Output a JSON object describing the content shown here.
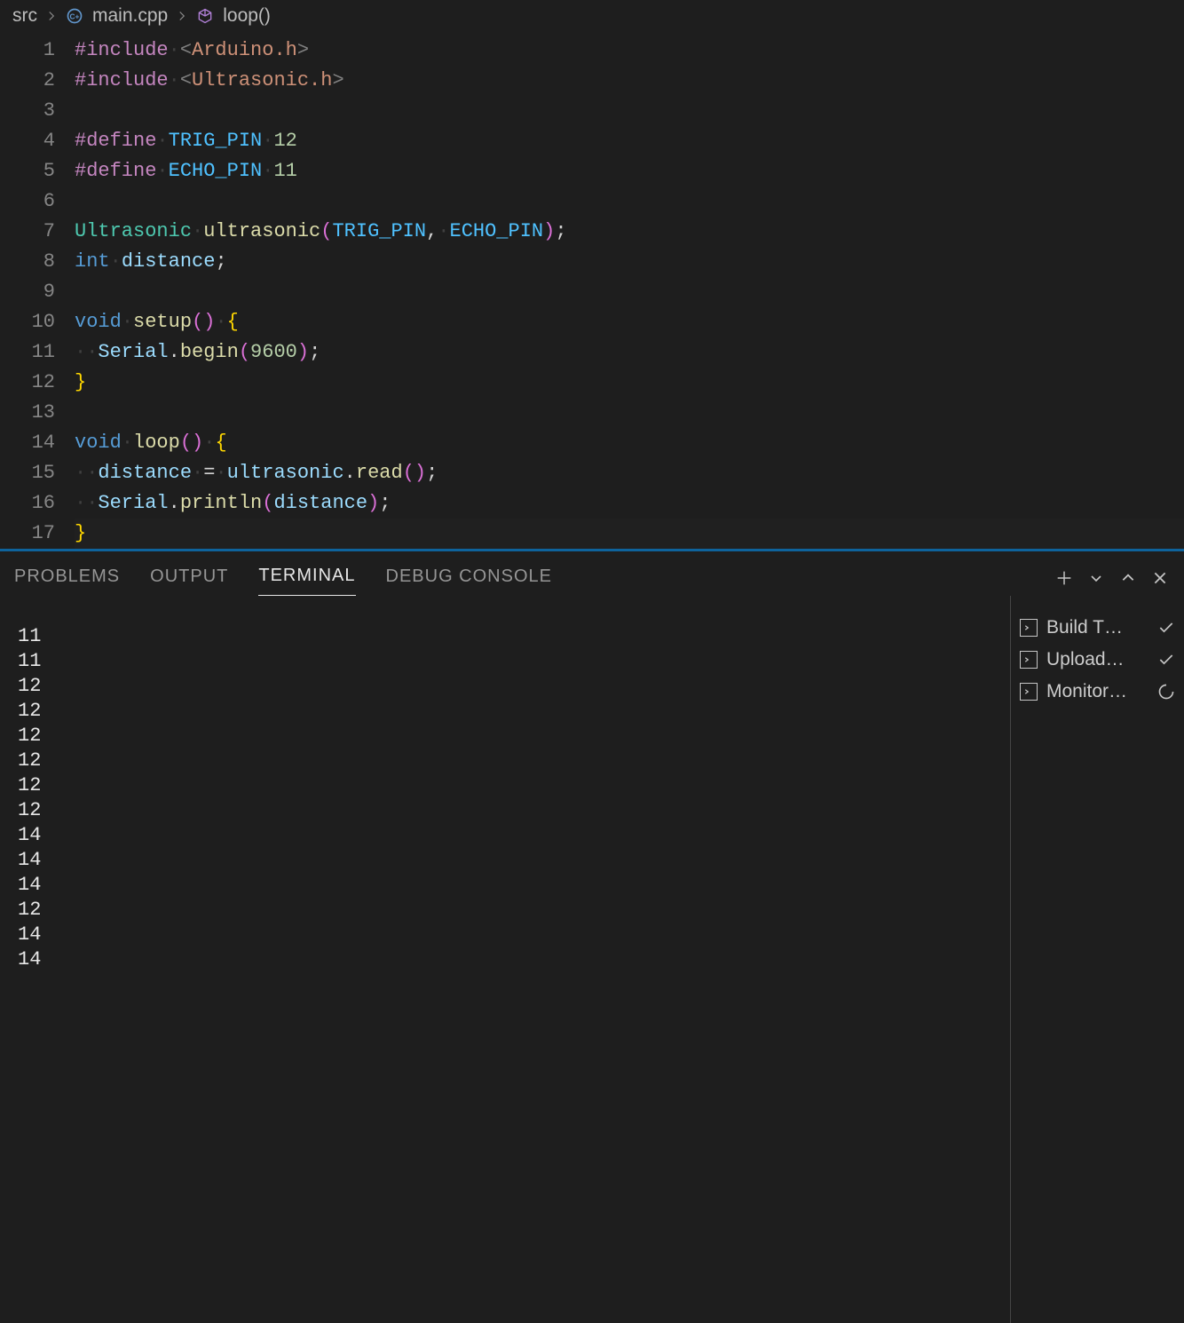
{
  "breadcrumb": {
    "folder": "src",
    "file": "main.cpp",
    "symbol": "loop()"
  },
  "code": {
    "lines": [
      {
        "n": 1,
        "tokens": [
          [
            "kw",
            "#include"
          ],
          [
            "ws",
            "·"
          ],
          [
            "angle",
            "<"
          ],
          [
            "str",
            "Arduino.h"
          ],
          [
            "angle",
            ">"
          ]
        ]
      },
      {
        "n": 2,
        "tokens": [
          [
            "kw",
            "#include"
          ],
          [
            "ws",
            "·"
          ],
          [
            "angle",
            "<"
          ],
          [
            "str",
            "Ultrasonic.h"
          ],
          [
            "angle",
            ">"
          ]
        ]
      },
      {
        "n": 3,
        "tokens": []
      },
      {
        "n": 4,
        "tokens": [
          [
            "kw",
            "#define"
          ],
          [
            "ws",
            "·"
          ],
          [
            "mac",
            "TRIG_PIN"
          ],
          [
            "ws",
            "·"
          ],
          [
            "num",
            "12"
          ]
        ]
      },
      {
        "n": 5,
        "tokens": [
          [
            "kw",
            "#define"
          ],
          [
            "ws",
            "·"
          ],
          [
            "mac",
            "ECHO_PIN"
          ],
          [
            "ws",
            "·"
          ],
          [
            "num",
            "11"
          ]
        ]
      },
      {
        "n": 6,
        "tokens": []
      },
      {
        "n": 7,
        "tokens": [
          [
            "type",
            "Ultrasonic"
          ],
          [
            "ws",
            "·"
          ],
          [
            "fn",
            "ultrasonic"
          ],
          [
            "paren",
            "("
          ],
          [
            "mac",
            "TRIG_PIN"
          ],
          [
            "op",
            ","
          ],
          [
            "ws",
            "·"
          ],
          [
            "mac",
            "ECHO_PIN"
          ],
          [
            "paren",
            ")"
          ],
          [
            "op",
            ";"
          ]
        ]
      },
      {
        "n": 8,
        "tokens": [
          [
            "pp",
            "int"
          ],
          [
            "ws",
            "·"
          ],
          [
            "id",
            "distance"
          ],
          [
            "op",
            ";"
          ]
        ]
      },
      {
        "n": 9,
        "tokens": []
      },
      {
        "n": 10,
        "tokens": [
          [
            "pp",
            "void"
          ],
          [
            "ws",
            "·"
          ],
          [
            "fn",
            "setup"
          ],
          [
            "paren",
            "("
          ],
          [
            "paren",
            ")"
          ],
          [
            "ws",
            "·"
          ],
          [
            "brace",
            "{"
          ]
        ]
      },
      {
        "n": 11,
        "tokens": [
          [
            "ws",
            "··"
          ],
          [
            "id",
            "Serial"
          ],
          [
            "op",
            "."
          ],
          [
            "fn",
            "begin"
          ],
          [
            "paren",
            "("
          ],
          [
            "num",
            "9600"
          ],
          [
            "paren",
            ")"
          ],
          [
            "op",
            ";"
          ]
        ]
      },
      {
        "n": 12,
        "tokens": [
          [
            "brace",
            "}"
          ]
        ]
      },
      {
        "n": 13,
        "tokens": []
      },
      {
        "n": 14,
        "tokens": [
          [
            "pp",
            "void"
          ],
          [
            "ws",
            "·"
          ],
          [
            "fn",
            "loop"
          ],
          [
            "paren",
            "("
          ],
          [
            "paren",
            ")"
          ],
          [
            "ws",
            "·"
          ],
          [
            "brace",
            "{"
          ]
        ]
      },
      {
        "n": 15,
        "tokens": [
          [
            "ws",
            "··"
          ],
          [
            "id",
            "distance"
          ],
          [
            "ws",
            "·"
          ],
          [
            "op",
            "="
          ],
          [
            "ws",
            "·"
          ],
          [
            "id",
            "ultrasonic"
          ],
          [
            "op",
            "."
          ],
          [
            "fn",
            "read"
          ],
          [
            "paren",
            "("
          ],
          [
            "paren",
            ")"
          ],
          [
            "op",
            ";"
          ]
        ]
      },
      {
        "n": 16,
        "tokens": [
          [
            "ws",
            "··"
          ],
          [
            "id",
            "Serial"
          ],
          [
            "op",
            "."
          ],
          [
            "fn",
            "println"
          ],
          [
            "paren",
            "("
          ],
          [
            "id",
            "distance"
          ],
          [
            "paren",
            ")"
          ],
          [
            "op",
            ";"
          ]
        ]
      },
      {
        "n": 17,
        "tokens": [
          [
            "brace",
            "}"
          ]
        ],
        "active": true
      }
    ]
  },
  "panel": {
    "tabs": [
      {
        "id": "problems",
        "label": "PROBLEMS",
        "active": false
      },
      {
        "id": "output",
        "label": "OUTPUT",
        "active": false
      },
      {
        "id": "terminal",
        "label": "TERMINAL",
        "active": true
      },
      {
        "id": "debug",
        "label": "DEBUG CONSOLE",
        "active": false
      }
    ],
    "terminal_output": [
      "11",
      "11",
      "12",
      "12",
      "12",
      "12",
      "12",
      "12",
      "14",
      "14",
      "14",
      "12",
      "14",
      "14"
    ],
    "tasks": [
      {
        "label": "Build  T…",
        "status": "check"
      },
      {
        "label": "Upload…",
        "status": "check"
      },
      {
        "label": "Monitor…",
        "status": "spinner"
      }
    ]
  }
}
